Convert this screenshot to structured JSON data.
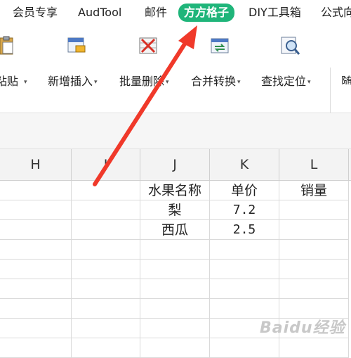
{
  "menu": {
    "tabs": [
      {
        "label": "会员专享"
      },
      {
        "label": "AudTool"
      },
      {
        "label": "邮件"
      },
      {
        "label": "方方格子",
        "active": true
      },
      {
        "label": "DIY工具箱"
      },
      {
        "label": "公式向"
      }
    ],
    "active_color": "#1fb57a"
  },
  "ribbon": {
    "buttons": [
      {
        "label": "粘贴",
        "icon": "paste-icon",
        "caret": "▾"
      },
      {
        "label": "新增插入",
        "icon": "insert-icon",
        "caret": "▾"
      },
      {
        "label": "批量删除",
        "icon": "delete-icon",
        "caret": "▾"
      },
      {
        "label": "合并转换",
        "icon": "merge-convert-icon",
        "caret": "▾"
      },
      {
        "label": "查找定位",
        "icon": "find-locate-icon",
        "caret": "▾"
      },
      {
        "label": "随"
      }
    ]
  },
  "sheet": {
    "columns": [
      "H",
      "I",
      "J",
      "K",
      "L"
    ],
    "rows": [
      [
        "",
        "",
        "水果名称",
        "单价",
        "销量"
      ],
      [
        "",
        "",
        "梨",
        "7.2",
        ""
      ],
      [
        "",
        "",
        "西瓜",
        "2.5",
        ""
      ],
      [
        "",
        "",
        "",
        "",
        ""
      ],
      [
        "",
        "",
        "",
        "",
        ""
      ],
      [
        "",
        "",
        "",
        "",
        ""
      ],
      [
        "",
        "",
        "",
        "",
        ""
      ],
      [
        "",
        "",
        "",
        "",
        ""
      ],
      [
        "",
        "",
        "",
        "",
        ""
      ]
    ]
  },
  "annotation": {
    "arrow_color": "#f0392a"
  },
  "watermark": "Baidu经验"
}
